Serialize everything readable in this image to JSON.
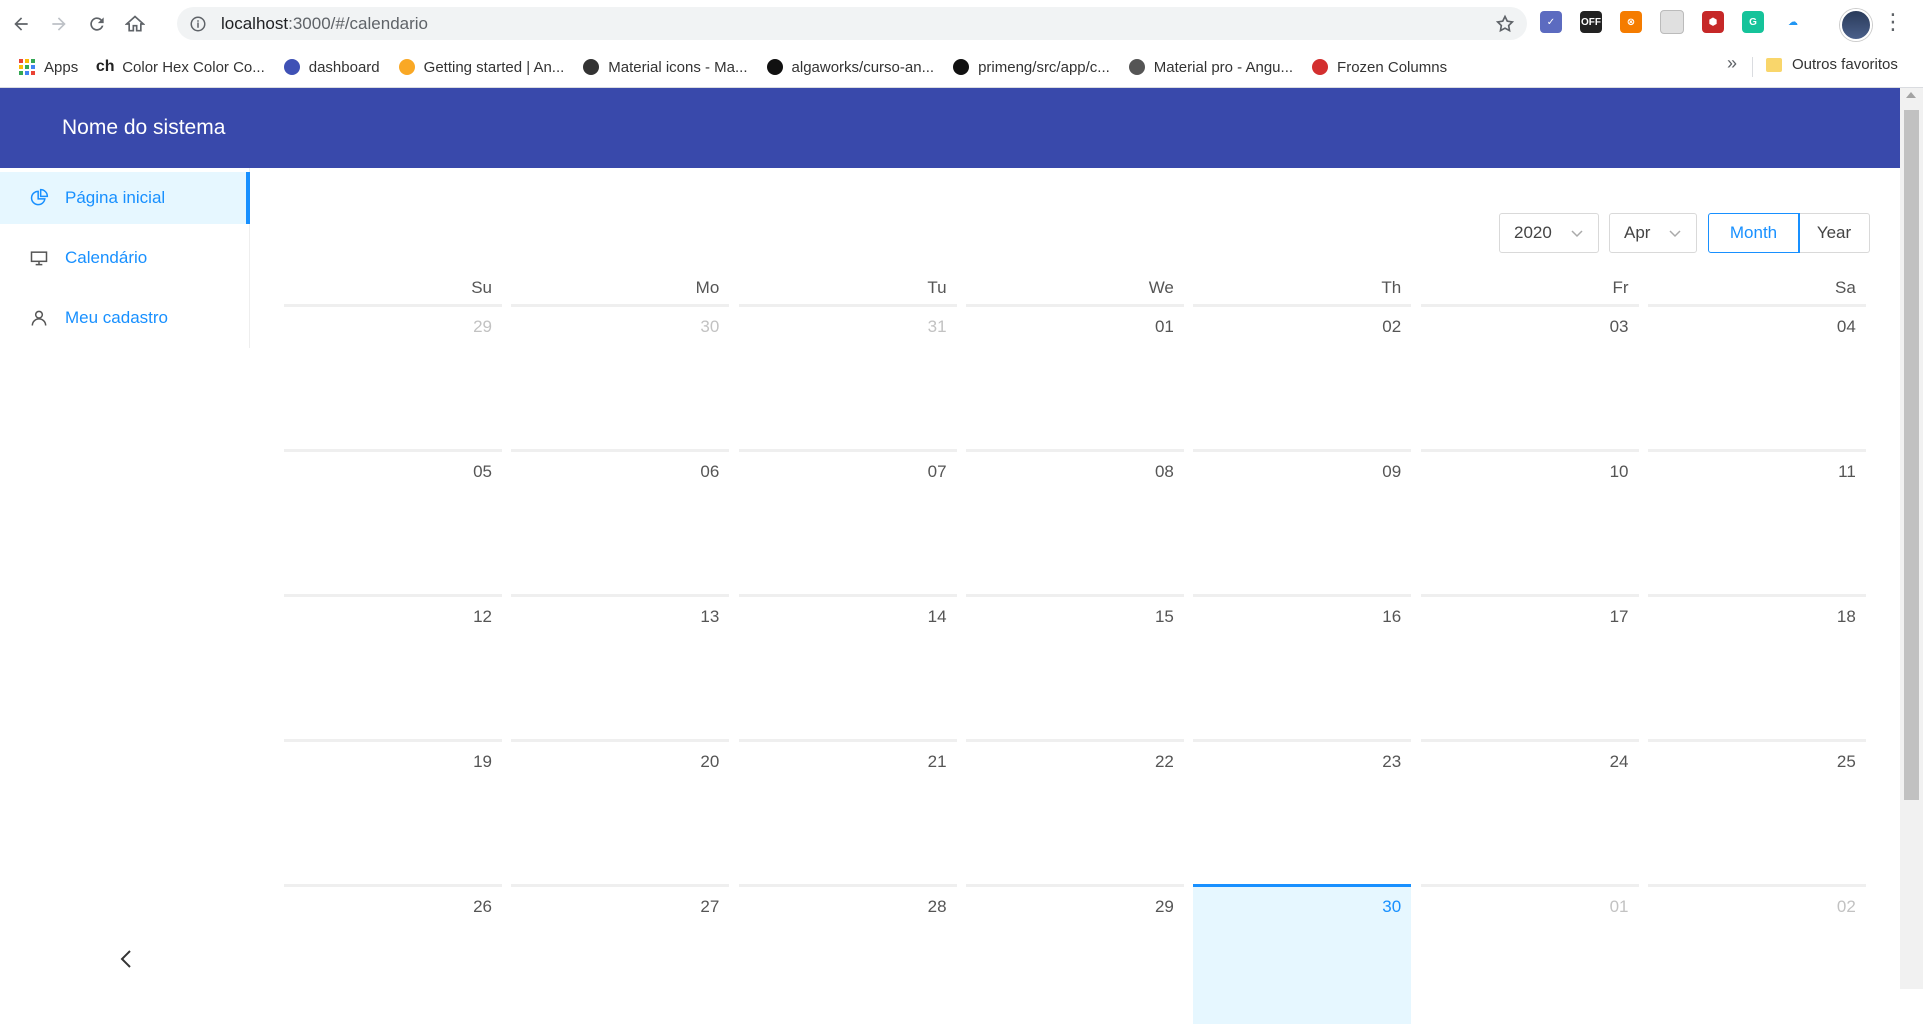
{
  "browser": {
    "url_host": "localhost",
    "url_rest": ":3000/#/calendario",
    "bookmarks": [
      {
        "label": "Apps",
        "icon": "apps-grid-icon"
      },
      {
        "label": "Color Hex Color Co...",
        "icon": "colorhex-icon",
        "icon_text": "ch"
      },
      {
        "label": "dashboard",
        "icon": "dashboard-icon"
      },
      {
        "label": "Getting started | An...",
        "icon": "angular-icon"
      },
      {
        "label": "Material icons - Ma...",
        "icon": "material-icon"
      },
      {
        "label": "algaworks/curso-an...",
        "icon": "github-icon"
      },
      {
        "label": "primeng/src/app/c...",
        "icon": "github-icon"
      },
      {
        "label": "Material pro - Angu...",
        "icon": "materialpro-icon"
      },
      {
        "label": "Frozen Columns",
        "icon": "primeng-shield-icon"
      }
    ],
    "other_bookmarks": "Outros favoritos",
    "more_symbol": "»",
    "extensions": [
      {
        "name": "checkmark-extension-icon",
        "color": "#5c6bc0",
        "text": "✓"
      },
      {
        "name": "off-extension-icon",
        "color": "#222222",
        "text": "OFF"
      },
      {
        "name": "orange-extension-icon",
        "color": "#f57c00",
        "text": "⊗"
      },
      {
        "name": "pocket-extension-icon",
        "color": "#e0e0e0",
        "text": ""
      },
      {
        "name": "shield-extension-icon",
        "color": "#c62828",
        "text": "⬢"
      },
      {
        "name": "grammarly-extension-icon",
        "color": "#15c39a",
        "text": "G"
      },
      {
        "name": "cloud-extension-icon",
        "color": "#ffffff",
        "text": "☁"
      }
    ]
  },
  "app": {
    "title": "Nome do sistema",
    "accent": "#1890ff",
    "header_color": "#3949ab"
  },
  "sidebar": {
    "items": [
      {
        "label": "Página inicial",
        "icon": "pie-chart-icon",
        "active": true
      },
      {
        "label": "Calendário",
        "icon": "desktop-icon",
        "active": false
      },
      {
        "label": "Meu cadastro",
        "icon": "user-icon",
        "active": false
      }
    ]
  },
  "calendar": {
    "year": "2020",
    "month": "Apr",
    "mode_month": "Month",
    "mode_year": "Year",
    "weekdays": [
      "Su",
      "Mo",
      "Tu",
      "We",
      "Th",
      "Fr",
      "Sa"
    ],
    "weeks": [
      [
        {
          "d": "29",
          "o": true
        },
        {
          "d": "30",
          "o": true
        },
        {
          "d": "31",
          "o": true
        },
        {
          "d": "01"
        },
        {
          "d": "02"
        },
        {
          "d": "03"
        },
        {
          "d": "04"
        }
      ],
      [
        {
          "d": "05"
        },
        {
          "d": "06"
        },
        {
          "d": "07"
        },
        {
          "d": "08"
        },
        {
          "d": "09"
        },
        {
          "d": "10"
        },
        {
          "d": "11"
        }
      ],
      [
        {
          "d": "12"
        },
        {
          "d": "13"
        },
        {
          "d": "14"
        },
        {
          "d": "15"
        },
        {
          "d": "16"
        },
        {
          "d": "17"
        },
        {
          "d": "18"
        }
      ],
      [
        {
          "d": "19"
        },
        {
          "d": "20"
        },
        {
          "d": "21"
        },
        {
          "d": "22"
        },
        {
          "d": "23"
        },
        {
          "d": "24"
        },
        {
          "d": "25"
        }
      ],
      [
        {
          "d": "26"
        },
        {
          "d": "27"
        },
        {
          "d": "28"
        },
        {
          "d": "29"
        },
        {
          "d": "30",
          "today": true
        },
        {
          "d": "01",
          "o": true
        },
        {
          "d": "02",
          "o": true
        }
      ]
    ]
  }
}
